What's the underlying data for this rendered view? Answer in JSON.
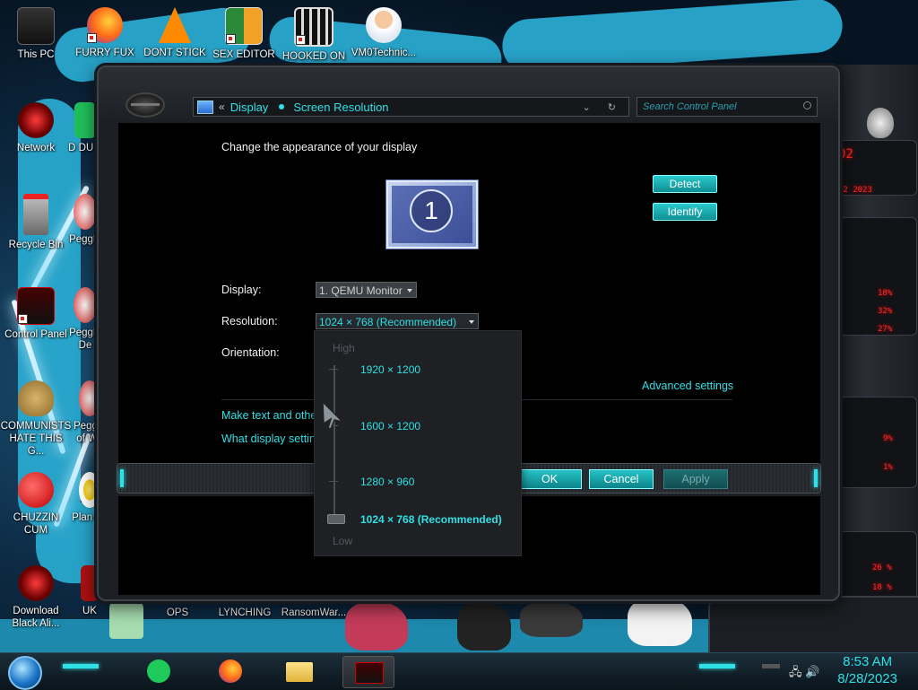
{
  "desktop": {
    "icons": [
      {
        "label": "This PC"
      },
      {
        "label": "FURRY FUX"
      },
      {
        "label": "DONT STICK"
      },
      {
        "label": "SEX EDITOR"
      },
      {
        "label": "HOOKED ON"
      },
      {
        "label": "VM0Technic..."
      },
      {
        "label": "Network"
      },
      {
        "label": "D DUM"
      },
      {
        "label": "Recycle Bin"
      },
      {
        "label": "Peggle"
      },
      {
        "label": "Control Panel"
      },
      {
        "label": "Peggle De"
      },
      {
        "label": "COMMUNISTS HATE THIS G..."
      },
      {
        "label": "Peggle of Wa"
      },
      {
        "label": "CHUZZIN CUM"
      },
      {
        "label": "Plan Zo"
      },
      {
        "label": "Download Black Ali..."
      },
      {
        "label": "UK"
      },
      {
        "label": "OPS"
      },
      {
        "label": "LYNCHING"
      },
      {
        "label": "RansomWar..."
      }
    ]
  },
  "window": {
    "breadcrumb": {
      "back_glyph": "«",
      "items": [
        "Display",
        "Screen Resolution"
      ]
    },
    "search": {
      "placeholder": "Search Control Panel"
    },
    "heading": "Change the appearance of your display",
    "monitor_number": "1",
    "detect_label": "Detect",
    "identify_label": "Identify",
    "display_label": "Display:",
    "display_value": "1. QEMU Monitor",
    "resolution_label": "Resolution:",
    "resolution_value": "1024 × 768 (Recommended)",
    "orientation_label": "Orientation:",
    "advanced_link": "Advanced settings",
    "link_text_size": "Make text and other",
    "link_display_settings": "What display setting",
    "ok_label": "OK",
    "cancel_label": "Cancel",
    "apply_label": "Apply"
  },
  "resolution_dropdown": {
    "high_label": "High",
    "low_label": "Low",
    "options": [
      "1920 × 1200",
      "1600 × 1200",
      "1280 × 960",
      "1024 × 768 (Recommended)"
    ],
    "selected_index": 3
  },
  "taskbar": {
    "time": "8:53 AM",
    "date": "8/28/2023"
  },
  "colors": {
    "accent": "#2fe0e6",
    "alien_red": "#ff2a2a"
  }
}
